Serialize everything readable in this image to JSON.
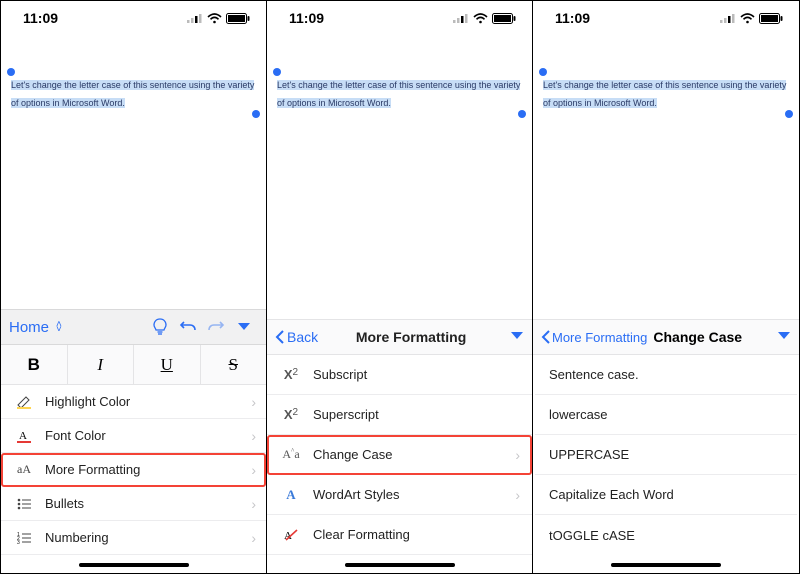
{
  "status": {
    "time": "11:09"
  },
  "document": {
    "selected_text": "Let's change the letter case of this sentence using the variety of options in Microsoft Word."
  },
  "panel1": {
    "toolbar": {
      "tab": "Home"
    },
    "format_buttons": {
      "bold": "B",
      "italic": "I",
      "underline": "U",
      "strike": "S"
    },
    "menu": {
      "highlight_color": "Highlight Color",
      "font_color": "Font Color",
      "more_formatting": "More Formatting",
      "bullets": "Bullets",
      "numbering": "Numbering"
    }
  },
  "panel2": {
    "back": "Back",
    "title": "More Formatting",
    "rows": {
      "subscript": "Subscript",
      "superscript": "Superscript",
      "change_case": "Change Case",
      "wordart": "WordArt Styles",
      "clear": "Clear Formatting"
    }
  },
  "panel3": {
    "back": "More Formatting",
    "title": "Change Case",
    "options": {
      "sentence": "Sentence case.",
      "lower": "lowercase",
      "upper": "UPPERCASE",
      "cap": "Capitalize Each Word",
      "toggle": "tOGGLE cASE"
    }
  }
}
